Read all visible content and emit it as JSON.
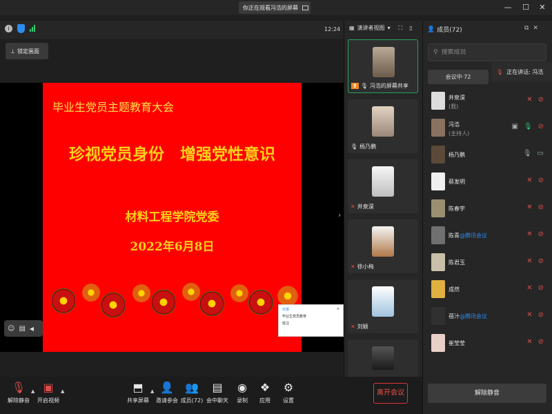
{
  "window": {
    "title": "你正在观看冯浩的屏幕",
    "minimize": "—",
    "maximize": "☐",
    "close": "✕"
  },
  "topbar": {
    "clock": "12:24",
    "lock_label": "锁定画面"
  },
  "slide": {
    "header": "毕业生党员主题教育大会",
    "title": "珍视党员身份　增强党性意识",
    "org": "材料工程学院党委",
    "date": "2022年6月8日"
  },
  "popup": {
    "title": "日报",
    "line1": "毕业生党员教育",
    "line2": "班注"
  },
  "middle": {
    "view_label": "演讲者视图",
    "tiles": [
      {
        "name": "冯浩的屏幕共享",
        "mic": "on",
        "color": "#8a7a6a"
      },
      {
        "name": "杨乃鹏",
        "mic": "on",
        "color": "#c9b8a8"
      },
      {
        "name": "井泉淏",
        "mic": "off",
        "color": "#eeeeee"
      },
      {
        "name": "徐小梅",
        "mic": "off",
        "color": "#b07848"
      },
      {
        "name": "刘颖",
        "mic": "off",
        "color": "#9fc3de"
      }
    ]
  },
  "panel": {
    "title": "成员(72)",
    "search_placeholder": "搜索成员",
    "tab_in_meeting": "会议中·72",
    "speaking": "正在讲话: 冯浩",
    "unmute_all": "解除静音",
    "members": [
      {
        "name": "井泉淏",
        "tag": "",
        "sub": "(我)",
        "av": "#dddddd",
        "mic": "off",
        "cam": "off"
      },
      {
        "name": "冯浩",
        "tag": "",
        "sub": "(主持人)",
        "av": "#8a7260",
        "mic": "green",
        "cam": "off",
        "share": true
      },
      {
        "name": "杨乃鹏",
        "tag": "",
        "sub": "",
        "av": "#5b4a3a",
        "mic": "on",
        "cam": "on"
      },
      {
        "name": "蔡发明",
        "tag": "",
        "sub": "",
        "av": "#f0f0f0",
        "mic": "off",
        "cam": "off"
      },
      {
        "name": "陈春宇",
        "tag": "",
        "sub": "",
        "av": "#9a8f70",
        "mic": "off",
        "cam": "off"
      },
      {
        "name": "陈青",
        "tag": "@腾讯会议",
        "sub": "",
        "av": "#707070",
        "mic": "off",
        "cam": "off"
      },
      {
        "name": "陈君玉",
        "tag": "",
        "sub": "",
        "av": "#c8c0a8",
        "mic": "off",
        "cam": "off"
      },
      {
        "name": "成然",
        "tag": "",
        "sub": "",
        "av": "#e0b040",
        "mic": "off",
        "cam": "off"
      },
      {
        "name": "蓓汁",
        "tag": "@腾讯会议",
        "sub": "",
        "av": "#303030",
        "mic": "off",
        "cam": "off"
      },
      {
        "name": "崔莹莹",
        "tag": "",
        "sub": "",
        "av": "#e8d0c8",
        "mic": "off",
        "cam": "off"
      }
    ]
  },
  "toolbar": {
    "unmute": "解除静音",
    "start_video": "开启视频",
    "share": "共享屏幕",
    "invite": "邀请参会",
    "members": "成员(72)",
    "chat": "会中聊天",
    "record": "录制",
    "apps": "应用",
    "settings": "设置",
    "leave": "离开会议"
  }
}
